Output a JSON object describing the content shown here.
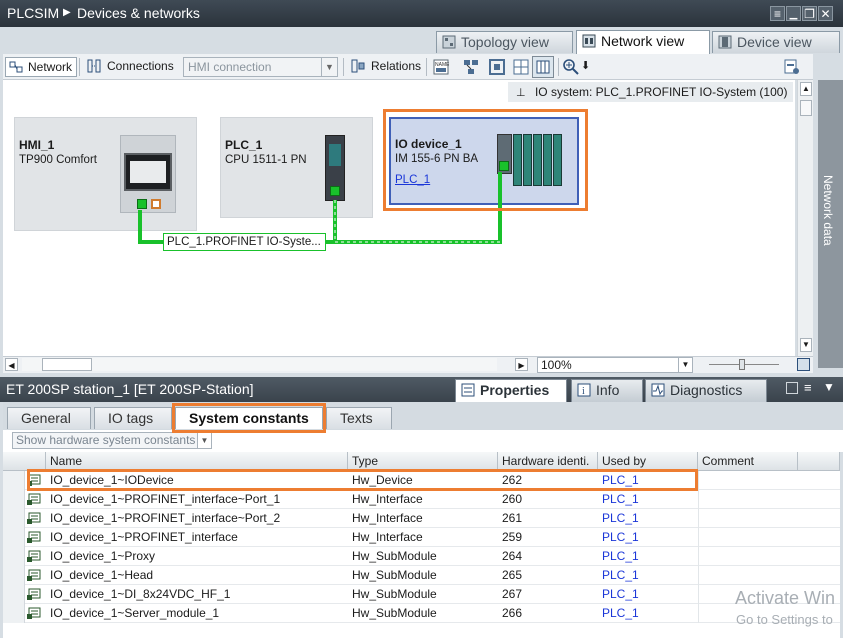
{
  "titlebar": {
    "app": "PLCSIM",
    "section": "Devices & networks"
  },
  "view_tabs": {
    "topology": "Topology view",
    "network": "Network view",
    "device": "Device view"
  },
  "toolbar": {
    "network": "Network",
    "connections": "Connections",
    "connection_type": "HMI connection",
    "relations": "Relations"
  },
  "io_system": "IO system: PLC_1.PROFINET IO-System (100)",
  "devices": {
    "hmi": {
      "name": "HMI_1",
      "type": "TP900 Comfort"
    },
    "plc": {
      "name": "PLC_1",
      "type": "CPU 1511-1 PN"
    },
    "io": {
      "name": "IO device_1",
      "type": "IM 155-6 PN BA",
      "link": "PLC_1"
    }
  },
  "network_label": "PLC_1.PROFINET IO-Syste...",
  "zoom": "100%",
  "side_panel": "Network data",
  "inspector": {
    "title": "ET 200SP station_1 [ET 200SP-Station]",
    "tabs": {
      "properties": "Properties",
      "info": "Info",
      "diagnostics": "Diagnostics"
    },
    "subtabs": {
      "general": "General",
      "io_tags": "IO tags",
      "system_constants": "System constants",
      "texts": "Texts"
    },
    "filter": "Show hardware system constants"
  },
  "table": {
    "headers": {
      "name": "Name",
      "type": "Type",
      "hwid": "Hardware identi.",
      "used_by": "Used by",
      "comment": "Comment"
    },
    "rows": [
      {
        "name": "IO_device_1~IODevice",
        "type": "Hw_Device",
        "hwid": "262",
        "used_by": "PLC_1"
      },
      {
        "name": "IO_device_1~PROFINET_interface~Port_1",
        "type": "Hw_Interface",
        "hwid": "260",
        "used_by": "PLC_1"
      },
      {
        "name": "IO_device_1~PROFINET_interface~Port_2",
        "type": "Hw_Interface",
        "hwid": "261",
        "used_by": "PLC_1"
      },
      {
        "name": "IO_device_1~PROFINET_interface",
        "type": "Hw_Interface",
        "hwid": "259",
        "used_by": "PLC_1"
      },
      {
        "name": "IO_device_1~Proxy",
        "type": "Hw_SubModule",
        "hwid": "264",
        "used_by": "PLC_1"
      },
      {
        "name": "IO_device_1~Head",
        "type": "Hw_SubModule",
        "hwid": "265",
        "used_by": "PLC_1"
      },
      {
        "name": "IO_device_1~DI_8x24VDC_HF_1",
        "type": "Hw_SubModule",
        "hwid": "267",
        "used_by": "PLC_1"
      },
      {
        "name": "IO_device_1~Server_module_1",
        "type": "Hw_SubModule",
        "hwid": "266",
        "used_by": "PLC_1"
      }
    ]
  },
  "watermark": {
    "line1": "Activate Win",
    "line2": "Go to Settings to"
  }
}
